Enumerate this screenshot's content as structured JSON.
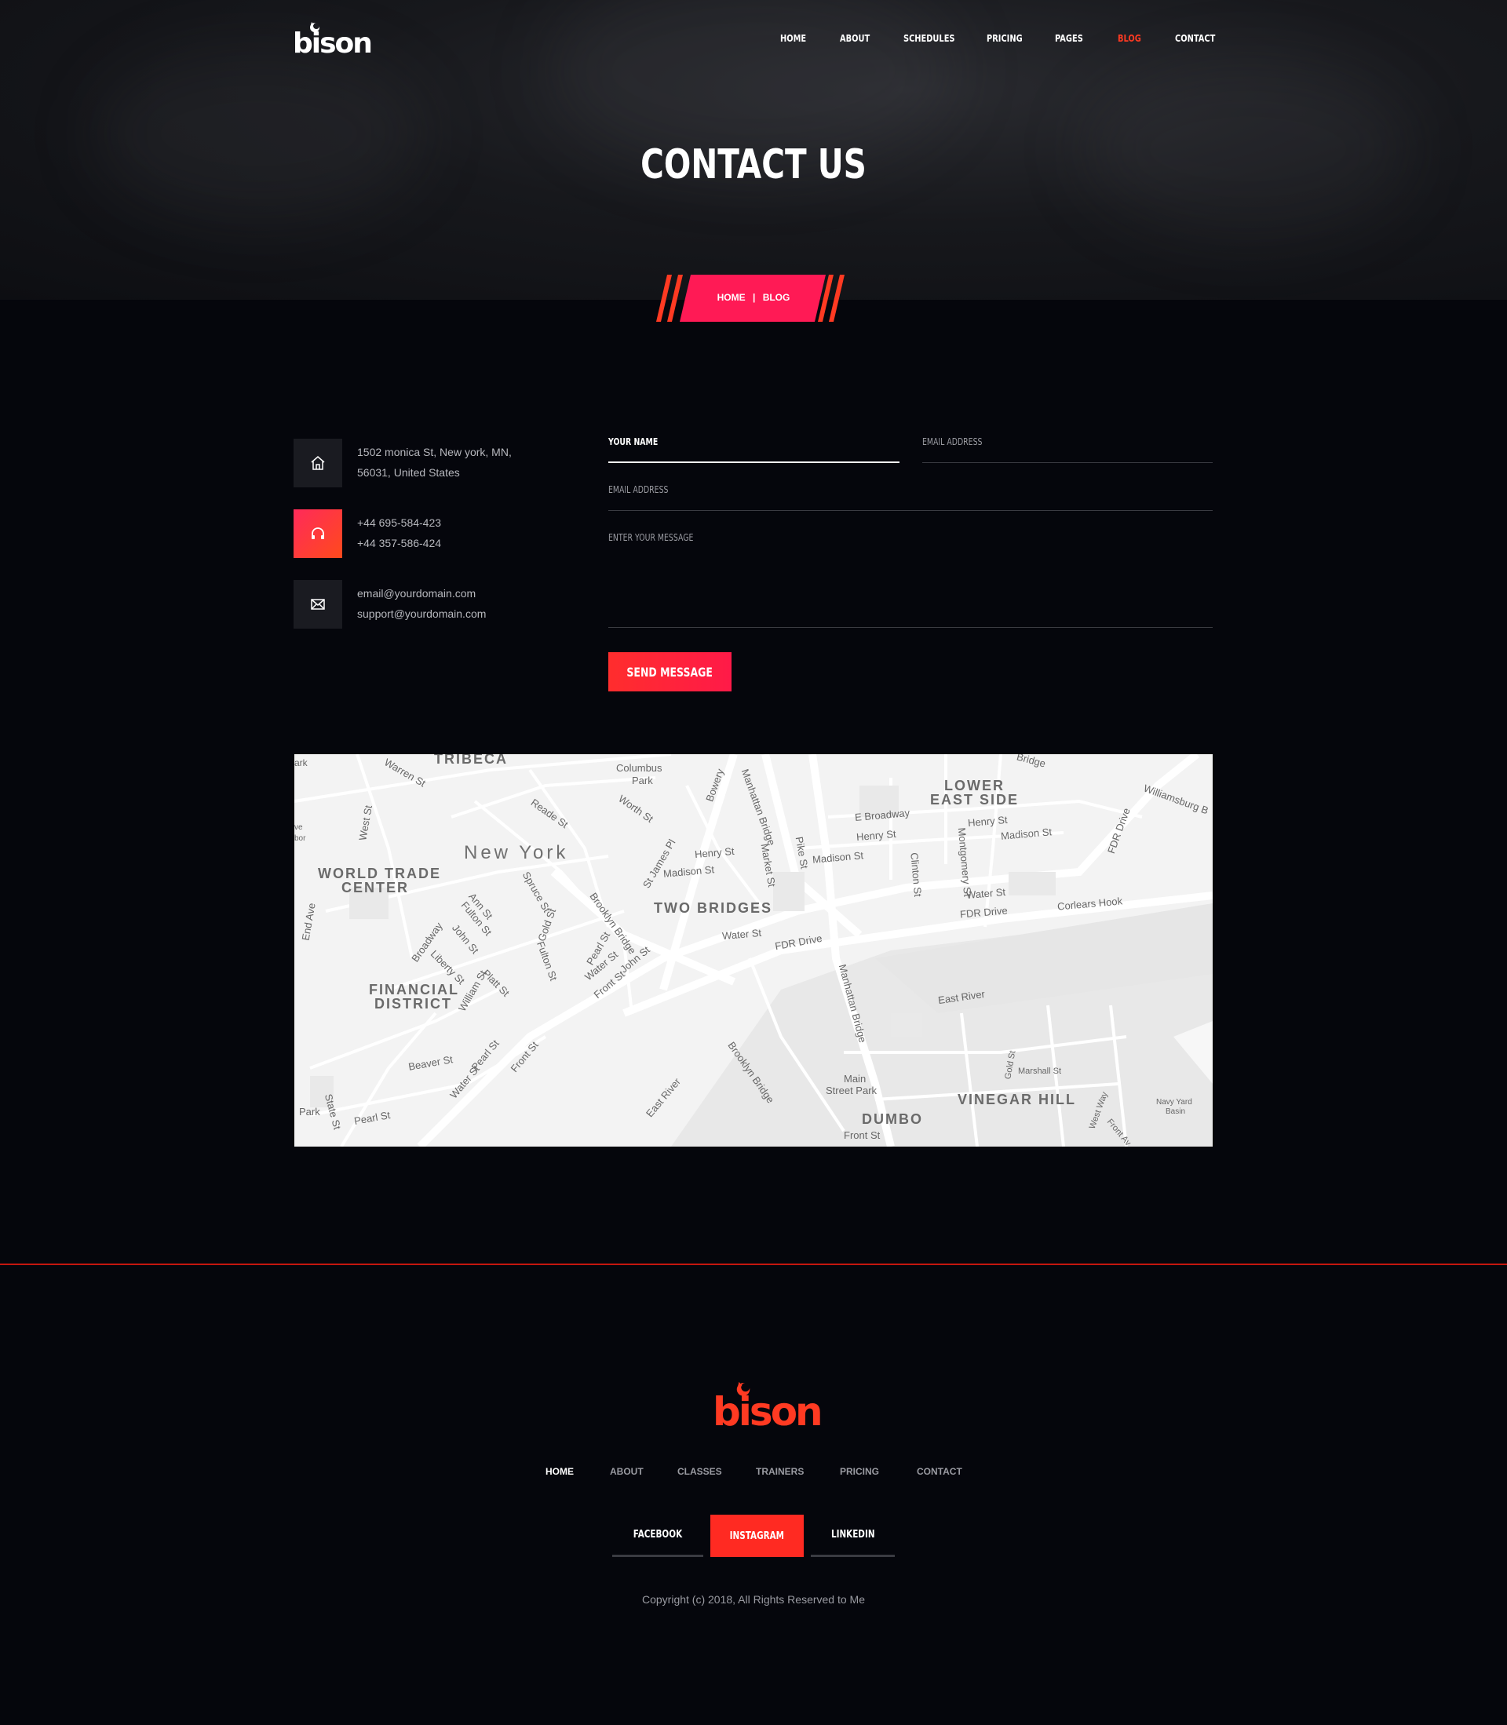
{
  "brand": {
    "name": "bison",
    "accent": "#ff3a22",
    "pink": "#ff1a55"
  },
  "nav": {
    "items": [
      "HOME",
      "ABOUT",
      "SCHEDULES",
      "PRICING",
      "PAGES",
      "BLOG",
      "CONTACT"
    ],
    "active": "BLOG"
  },
  "hero": {
    "title": "CONTACT US"
  },
  "breadcrumb": {
    "home": "HOME",
    "separator": "|",
    "current": "BLOG"
  },
  "contact": {
    "address": {
      "icon": "home-icon",
      "line1": "1502 monica St, New york, MN,",
      "line2": "56031, United States"
    },
    "phone": {
      "icon": "headphones-icon",
      "line1": "+44 695-584-423",
      "line2": "+44 357-586-424"
    },
    "email": {
      "icon": "envelope-icon",
      "line1": "email@yourdomain.com",
      "line2": "support@yourdomain.com"
    }
  },
  "form": {
    "name_label": "YOUR NAME",
    "email_label_1": "EMAIL ADDRESS",
    "email_label_2": "EMAIL ADDRESS",
    "message_label": "ENTER YOUR MESSAGE",
    "send_label": "SEND MESSAGE"
  },
  "map": {
    "labels": {
      "tribeca": "TRIBECA",
      "columbus": "Columbus",
      "park": "Park",
      "lower": "LOWER",
      "east_side": "EAST SIDE",
      "new_york": "New York",
      "wtc1": "WORLD TRADE",
      "wtc2": "CENTER",
      "two_bridges": "TWO BRIDGES",
      "fin1": "FINANCIAL",
      "fin2": "DISTRICT",
      "vinegar": "VINEGAR HILL",
      "dumbo": "DUMBO",
      "east_river": "East River",
      "east_river2": "East River",
      "corlears": "Corlears Hook",
      "main1": "Main",
      "main2": "Street Park",
      "warren": "Warren St",
      "reade": "Reade St",
      "worth": "Worth St",
      "bowery": "Bowery",
      "manhattan_br": "Manhattan Bridge",
      "manhattan_br2": "Manhattan Bridge",
      "henry1": "Henry St",
      "henry2": "Henry St",
      "henry3": "Henry St",
      "madison1": "Madison St",
      "madison2": "Madison St",
      "madison3": "Madison St",
      "e_broadway": "E Broadway",
      "pike": "Pike St",
      "market": "Market St",
      "clinton": "Clinton St",
      "montgomery": "Montgomery St",
      "water1": "Water St",
      "water2": "Water St",
      "water3": "Water St",
      "water4": "Water St",
      "fdr1": "FDR Drive",
      "fdr2": "FDR Drive",
      "fdr3": "FDR Drive",
      "williamsburg": "Williamsburg B",
      "delancey": "Bridge",
      "brooklyn_br": "Brooklyn Bridge",
      "brooklyn_br2": "Brooklyn Bridge",
      "spruce": "Spruce St",
      "gold": "Gold St",
      "ann": "Ann St",
      "fulton1": "Fulton St",
      "fulton2": "Fulton St",
      "john1": "John St",
      "john2": "John St",
      "broadway": "Broadway",
      "liberty": "Liberty St",
      "william": "William St",
      "platt": "Platt St",
      "pearl1": "Pearl St",
      "pearl2": "Pearl St",
      "pearl3": "Pearl St",
      "front1": "Front St",
      "front2": "Front St",
      "front3": "Front St",
      "beaver": "Beaver St",
      "state": "State St",
      "west": "West St",
      "st_james": "St James Pl",
      "park2": "Park",
      "end_ave": "End Ave",
      "marshall": "Marshall St",
      "gold2": "Gold St",
      "navy1": "Navy Yard",
      "navy2": "Basin",
      "west_way": "West Way",
      "front_ave": "Front Av",
      "bor": "bor",
      "ve": "ve",
      "ark": "ark"
    }
  },
  "footer": {
    "nav": [
      "HOME",
      "ABOUT",
      "CLASSES",
      "TRAINERS",
      "PRICING",
      "CONTACT"
    ],
    "nav_active": "HOME",
    "social": [
      "FACEBOOK",
      "INSTAGRAM",
      "LINKEDIN"
    ],
    "social_active": "INSTAGRAM",
    "copyright": "Copyright (c) 2018, All Rights Reserved to Me"
  }
}
